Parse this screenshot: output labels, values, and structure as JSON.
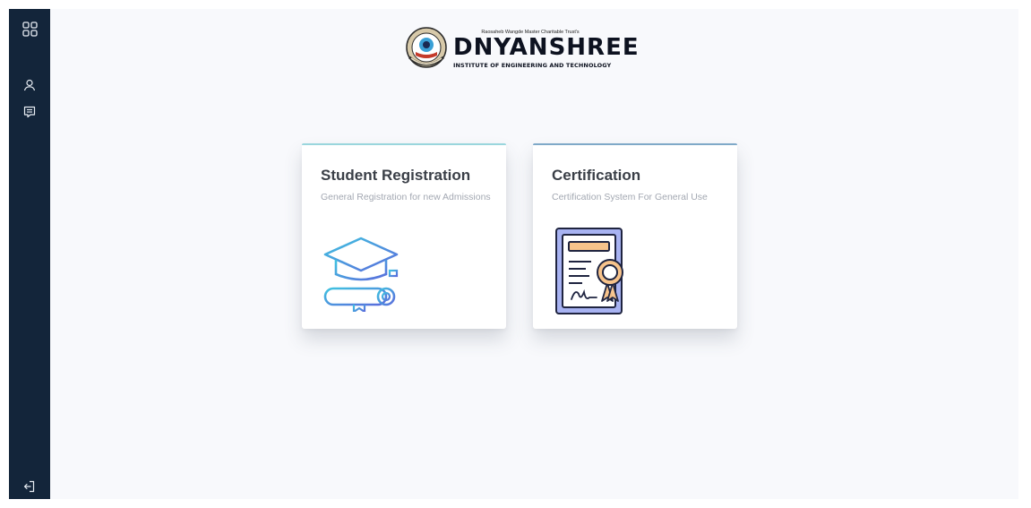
{
  "sidebar": {
    "icons": [
      {
        "name": "dashboard-grid-icon"
      },
      {
        "name": "user-icon"
      },
      {
        "name": "message-icon"
      },
      {
        "name": "logout-icon"
      }
    ]
  },
  "logo": {
    "trust_text": "Raosaheb Wangde Master Charitable Trust's",
    "name": "DNYANSHREE",
    "subtitle": "INSTITUTE OF ENGINEERING AND TECHNOLOGY"
  },
  "cards": [
    {
      "title": "Student Registration",
      "description": "General Registration for new Admissions",
      "accent": "#9ad6dd",
      "icon": "graduation-cap-diploma-icon"
    },
    {
      "title": "Certification",
      "description": "Certification System For General Use",
      "accent": "#7fa9c8",
      "icon": "certificate-icon"
    }
  ],
  "colors": {
    "sidebar_bg": "#13253a",
    "main_bg": "#f8f9fc",
    "card_bg": "#ffffff"
  }
}
